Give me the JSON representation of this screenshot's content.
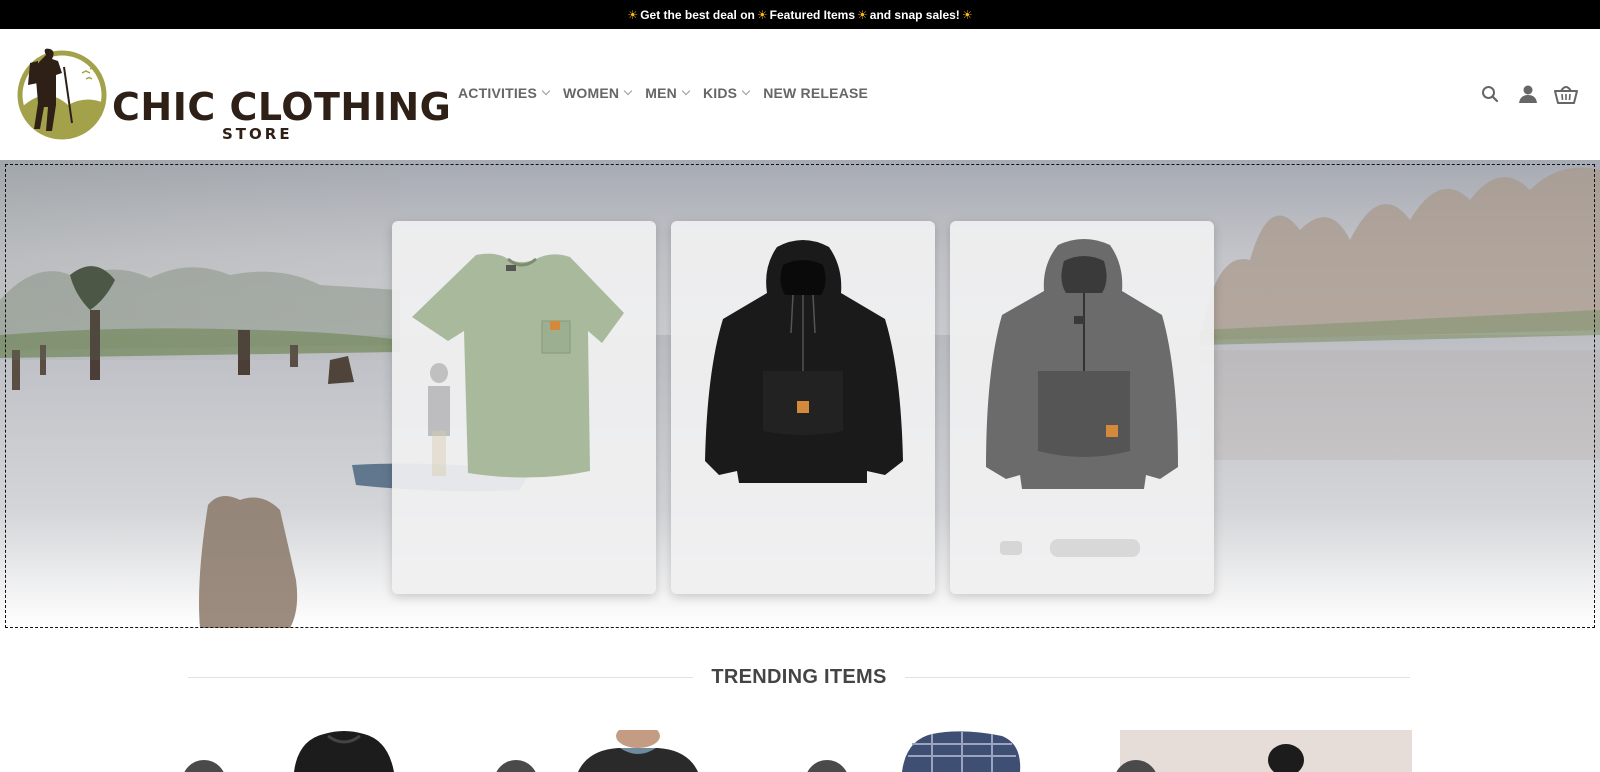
{
  "topbar": {
    "text_before": "Get the best deal on",
    "featured": "Featured Items",
    "text_after": "and snap sales!"
  },
  "header": {
    "logo_title": "CHIC CLOTHING",
    "logo_sub": "STORE",
    "nav": [
      {
        "label": "ACTIVITIES",
        "dropdown": true
      },
      {
        "label": "WOMEN",
        "dropdown": true
      },
      {
        "label": "MEN",
        "dropdown": true
      },
      {
        "label": "KIDS",
        "dropdown": true
      },
      {
        "label": "NEW RELEASE",
        "dropdown": false
      }
    ],
    "icons": [
      "search-icon",
      "account-icon",
      "cart-icon"
    ]
  },
  "hero": {
    "cards": [
      {
        "product": "green t-shirt",
        "color": "#a8b99c"
      },
      {
        "product": "black hoodie",
        "color": "#1a1a1a"
      },
      {
        "product": "gray anorak",
        "color": "#6b6b6b"
      }
    ]
  },
  "trending": {
    "title": "TRENDING ITEMS"
  },
  "colors": {
    "brand_green": "#a3a24a",
    "brand_dark": "#2e2016",
    "topbar_bg": "#000000",
    "sun": "#f5b81b"
  }
}
